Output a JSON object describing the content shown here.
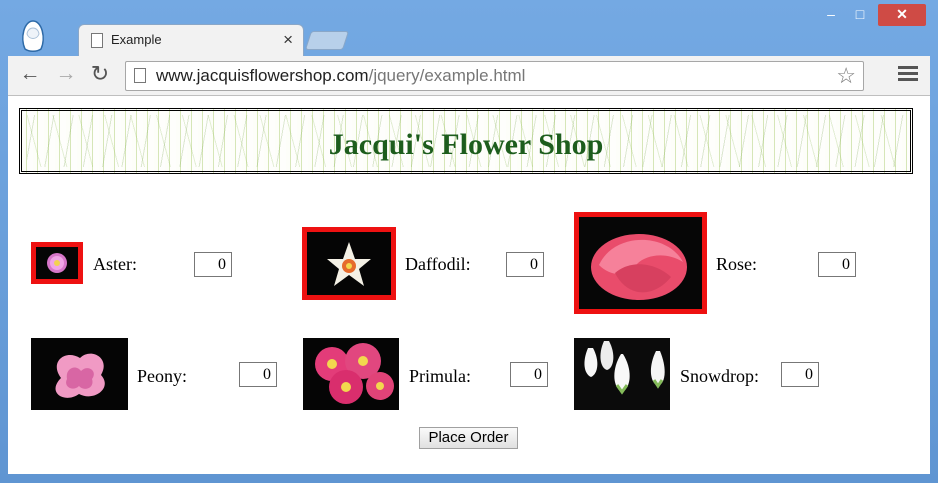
{
  "browser": {
    "tab_title": "Example",
    "tab_close": "×",
    "url_host": "www.jacquisflowershop.com",
    "url_path": "/jquery/example.html",
    "window_controls": {
      "minimize": "–",
      "maximize": "□",
      "close": "✕"
    },
    "icons": {
      "back": "back-arrow-icon",
      "forward": "forward-arrow-icon",
      "reload": "reload-icon",
      "star": "star-icon",
      "menu": "menu-icon"
    }
  },
  "page": {
    "title": "Jacqui's Flower Shop",
    "place_order": "Place Order",
    "products": [
      {
        "name": "Aster",
        "label": "Aster:",
        "qty": "0",
        "highlight": true
      },
      {
        "name": "Daffodil",
        "label": "Daffodil:",
        "qty": "0",
        "highlight": true
      },
      {
        "name": "Rose",
        "label": "Rose:",
        "qty": "0",
        "highlight": true
      },
      {
        "name": "Peony",
        "label": "Peony:",
        "qty": "0",
        "highlight": false
      },
      {
        "name": "Primula",
        "label": "Primula:",
        "qty": "0",
        "highlight": false
      },
      {
        "name": "Snowdrop",
        "label": "Snowdrop:",
        "qty": "0",
        "highlight": false
      }
    ],
    "colors": {
      "highlight_border": "#ee1111",
      "title": "#1d5d1d"
    }
  }
}
